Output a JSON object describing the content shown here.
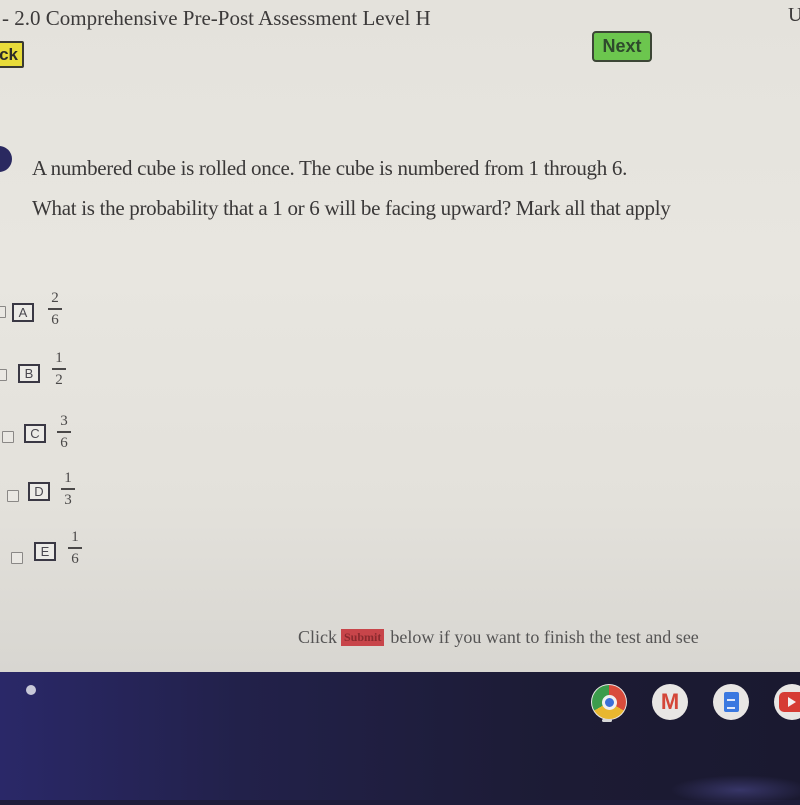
{
  "header": {
    "title": "2.0 Comprehensive Pre-Post Assessment Level H",
    "title_prefix_cut": "-",
    "title_right_cut": "U",
    "back_label": "ck",
    "next_label": "Next"
  },
  "question": {
    "line1": "A numbered cube is rolled once.  The cube is numbered from 1 through 6.",
    "line2": "What is the probability that a 1 or 6 will be facing upward?  Mark all that apply"
  },
  "options": [
    {
      "letter": "A",
      "numerator": "2",
      "denominator": "6",
      "checked": false
    },
    {
      "letter": "B",
      "numerator": "1",
      "denominator": "2",
      "checked": false
    },
    {
      "letter": "C",
      "numerator": "3",
      "denominator": "6",
      "checked": false
    },
    {
      "letter": "D",
      "numerator": "1",
      "denominator": "3",
      "checked": false
    },
    {
      "letter": "E",
      "numerator": "1",
      "denominator": "6",
      "checked": false
    }
  ],
  "footer": {
    "before": "Click",
    "submit_word": "Submit",
    "after": "below if you want to finish the test and see"
  },
  "shelf": {
    "apps": [
      {
        "name": "Chrome",
        "icon": "chrome-icon",
        "running": true
      },
      {
        "name": "Gmail",
        "icon": "gmail-icon",
        "glyph": "M"
      },
      {
        "name": "Docs",
        "icon": "docs-icon"
      },
      {
        "name": "YouTube",
        "icon": "youtube-icon"
      }
    ]
  },
  "colors": {
    "next_button": "#6cc64e",
    "back_button": "#e8dc3a",
    "submit_highlight": "#c8454a",
    "shelf": "#1e1c3a"
  }
}
